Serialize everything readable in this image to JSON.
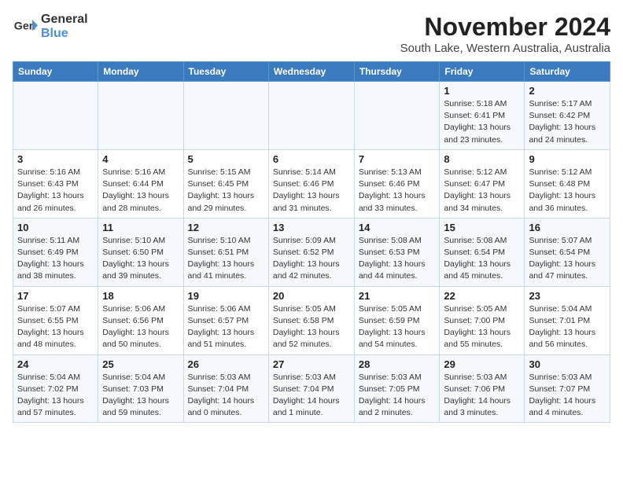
{
  "app": {
    "name": "GeneralBlue",
    "logo_line1": "General",
    "logo_line2": "Blue"
  },
  "title": "November 2024",
  "subtitle": "South Lake, Western Australia, Australia",
  "headers": [
    "Sunday",
    "Monday",
    "Tuesday",
    "Wednesday",
    "Thursday",
    "Friday",
    "Saturday"
  ],
  "weeks": [
    [
      {
        "day": "",
        "info": ""
      },
      {
        "day": "",
        "info": ""
      },
      {
        "day": "",
        "info": ""
      },
      {
        "day": "",
        "info": ""
      },
      {
        "day": "",
        "info": ""
      },
      {
        "day": "1",
        "info": "Sunrise: 5:18 AM\nSunset: 6:41 PM\nDaylight: 13 hours\nand 23 minutes."
      },
      {
        "day": "2",
        "info": "Sunrise: 5:17 AM\nSunset: 6:42 PM\nDaylight: 13 hours\nand 24 minutes."
      }
    ],
    [
      {
        "day": "3",
        "info": "Sunrise: 5:16 AM\nSunset: 6:43 PM\nDaylight: 13 hours\nand 26 minutes."
      },
      {
        "day": "4",
        "info": "Sunrise: 5:16 AM\nSunset: 6:44 PM\nDaylight: 13 hours\nand 28 minutes."
      },
      {
        "day": "5",
        "info": "Sunrise: 5:15 AM\nSunset: 6:45 PM\nDaylight: 13 hours\nand 29 minutes."
      },
      {
        "day": "6",
        "info": "Sunrise: 5:14 AM\nSunset: 6:46 PM\nDaylight: 13 hours\nand 31 minutes."
      },
      {
        "day": "7",
        "info": "Sunrise: 5:13 AM\nSunset: 6:46 PM\nDaylight: 13 hours\nand 33 minutes."
      },
      {
        "day": "8",
        "info": "Sunrise: 5:12 AM\nSunset: 6:47 PM\nDaylight: 13 hours\nand 34 minutes."
      },
      {
        "day": "9",
        "info": "Sunrise: 5:12 AM\nSunset: 6:48 PM\nDaylight: 13 hours\nand 36 minutes."
      }
    ],
    [
      {
        "day": "10",
        "info": "Sunrise: 5:11 AM\nSunset: 6:49 PM\nDaylight: 13 hours\nand 38 minutes."
      },
      {
        "day": "11",
        "info": "Sunrise: 5:10 AM\nSunset: 6:50 PM\nDaylight: 13 hours\nand 39 minutes."
      },
      {
        "day": "12",
        "info": "Sunrise: 5:10 AM\nSunset: 6:51 PM\nDaylight: 13 hours\nand 41 minutes."
      },
      {
        "day": "13",
        "info": "Sunrise: 5:09 AM\nSunset: 6:52 PM\nDaylight: 13 hours\nand 42 minutes."
      },
      {
        "day": "14",
        "info": "Sunrise: 5:08 AM\nSunset: 6:53 PM\nDaylight: 13 hours\nand 44 minutes."
      },
      {
        "day": "15",
        "info": "Sunrise: 5:08 AM\nSunset: 6:54 PM\nDaylight: 13 hours\nand 45 minutes."
      },
      {
        "day": "16",
        "info": "Sunrise: 5:07 AM\nSunset: 6:54 PM\nDaylight: 13 hours\nand 47 minutes."
      }
    ],
    [
      {
        "day": "17",
        "info": "Sunrise: 5:07 AM\nSunset: 6:55 PM\nDaylight: 13 hours\nand 48 minutes."
      },
      {
        "day": "18",
        "info": "Sunrise: 5:06 AM\nSunset: 6:56 PM\nDaylight: 13 hours\nand 50 minutes."
      },
      {
        "day": "19",
        "info": "Sunrise: 5:06 AM\nSunset: 6:57 PM\nDaylight: 13 hours\nand 51 minutes."
      },
      {
        "day": "20",
        "info": "Sunrise: 5:05 AM\nSunset: 6:58 PM\nDaylight: 13 hours\nand 52 minutes."
      },
      {
        "day": "21",
        "info": "Sunrise: 5:05 AM\nSunset: 6:59 PM\nDaylight: 13 hours\nand 54 minutes."
      },
      {
        "day": "22",
        "info": "Sunrise: 5:05 AM\nSunset: 7:00 PM\nDaylight: 13 hours\nand 55 minutes."
      },
      {
        "day": "23",
        "info": "Sunrise: 5:04 AM\nSunset: 7:01 PM\nDaylight: 13 hours\nand 56 minutes."
      }
    ],
    [
      {
        "day": "24",
        "info": "Sunrise: 5:04 AM\nSunset: 7:02 PM\nDaylight: 13 hours\nand 57 minutes."
      },
      {
        "day": "25",
        "info": "Sunrise: 5:04 AM\nSunset: 7:03 PM\nDaylight: 13 hours\nand 59 minutes."
      },
      {
        "day": "26",
        "info": "Sunrise: 5:03 AM\nSunset: 7:04 PM\nDaylight: 14 hours\nand 0 minutes."
      },
      {
        "day": "27",
        "info": "Sunrise: 5:03 AM\nSunset: 7:04 PM\nDaylight: 14 hours\nand 1 minute."
      },
      {
        "day": "28",
        "info": "Sunrise: 5:03 AM\nSunset: 7:05 PM\nDaylight: 14 hours\nand 2 minutes."
      },
      {
        "day": "29",
        "info": "Sunrise: 5:03 AM\nSunset: 7:06 PM\nDaylight: 14 hours\nand 3 minutes."
      },
      {
        "day": "30",
        "info": "Sunrise: 5:03 AM\nSunset: 7:07 PM\nDaylight: 14 hours\nand 4 minutes."
      }
    ]
  ]
}
